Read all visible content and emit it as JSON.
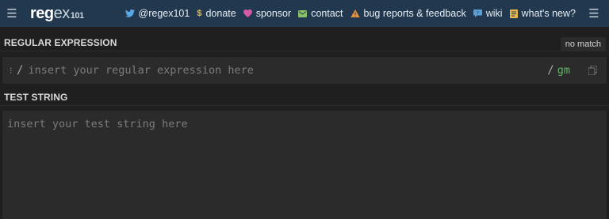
{
  "header": {
    "logo_main": "reg",
    "logo_mid": "ex",
    "logo_num": "101",
    "nav": [
      {
        "label": "@regex101",
        "icon": "twitter-icon"
      },
      {
        "label": "donate",
        "icon": "dollar-icon"
      },
      {
        "label": "sponsor",
        "icon": "heart-icon"
      },
      {
        "label": "contact",
        "icon": "envelope-icon"
      },
      {
        "label": "bug reports & feedback",
        "icon": "warning-icon"
      },
      {
        "label": "wiki",
        "icon": "chat-icon"
      },
      {
        "label": "what's new?",
        "icon": "news-icon"
      }
    ]
  },
  "regex": {
    "section_label": "REGULAR EXPRESSION",
    "status": "no match",
    "delimiter_open": "/",
    "delimiter_close": "/",
    "flags": "gm",
    "placeholder": "insert your regular expression here"
  },
  "test": {
    "section_label": "TEST STRING",
    "placeholder": "insert your test string here"
  },
  "colors": {
    "header_bg": "#22384f",
    "page_bg": "#1f1f1f",
    "panel_bg": "#2b2b2b",
    "flags": "#63b06a"
  }
}
